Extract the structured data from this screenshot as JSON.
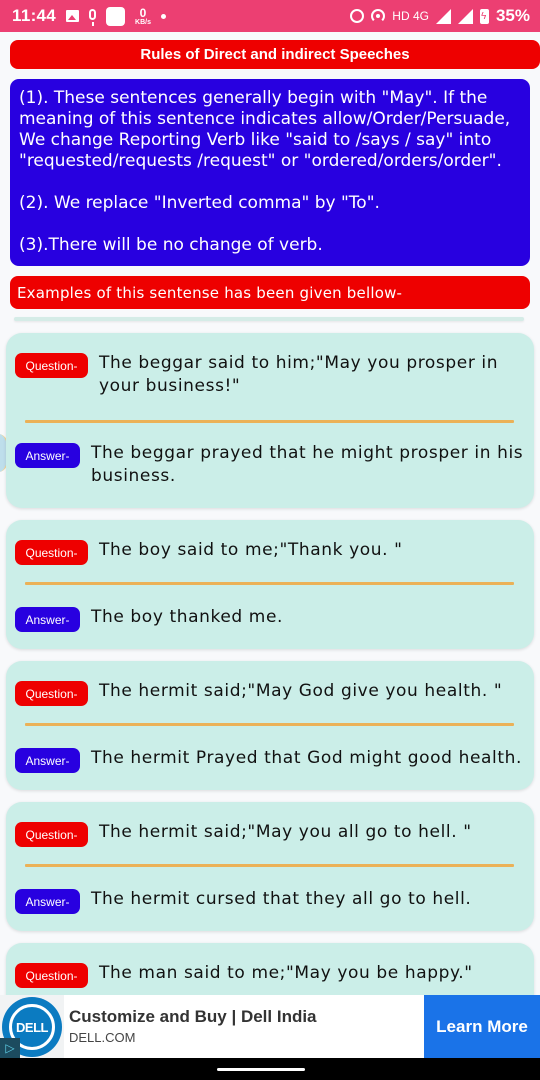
{
  "status_bar": {
    "time": "11:44",
    "net_speed_value": "0",
    "net_speed_unit": "KB/s",
    "network_label": "HD 4G",
    "battery": "35%",
    "icons": [
      "image-icon",
      "mic-icon",
      "square-icon",
      "dot-icon",
      "alarm-icon",
      "hotspot-icon",
      "signal-icon",
      "signal-icon",
      "battery-charging-icon"
    ]
  },
  "header": {
    "title": "Rules of Direct and indirect Speeches"
  },
  "rules": [
    "(1). These sentences generally begin with \"May\". If the meaning of this sentence indicates allow/Order/Persuade, We change Reporting Verb like \"said to /says / say\" into \"requested/requests /request\" or \"ordered/orders/order\".",
    "(2). We replace \"Inverted comma\" by \"To\".",
    "(3).There will be no change of verb."
  ],
  "examples_header": "Examples of this sentense has been given bellow-",
  "labels": {
    "question": "Question-",
    "answer": "Answer-"
  },
  "examples": [
    {
      "question": "The beggar said to him;\"May you prosper in your business!\"",
      "answer": "The beggar prayed that he might prosper in his business."
    },
    {
      "question": "The boy said to me;\"Thank you. \"",
      "answer": "The boy thanked me."
    },
    {
      "question": "The hermit said;\"May God give you health. \"",
      "answer": "The hermit Prayed that God might good health."
    },
    {
      "question": "The hermit said;\"May you all go to hell. \"",
      "answer": "The hermit cursed that they all go to hell."
    },
    {
      "question": "The man said to me;\"May you be happy.\""
    }
  ],
  "ad": {
    "logo_text": "DELL",
    "title": "Customize and Buy | Dell India",
    "domain": "DELL.COM",
    "cta": "Learn More",
    "adchoice_glyph": "▷"
  },
  "colors": {
    "status_bar": "#ec3f72",
    "red": "#ee0000",
    "blue": "#2800e0",
    "card_bg": "#cbeee8",
    "divider": "#ebb157",
    "ad_cta": "#1a73e8",
    "dell_blue": "#0b7bc1"
  }
}
